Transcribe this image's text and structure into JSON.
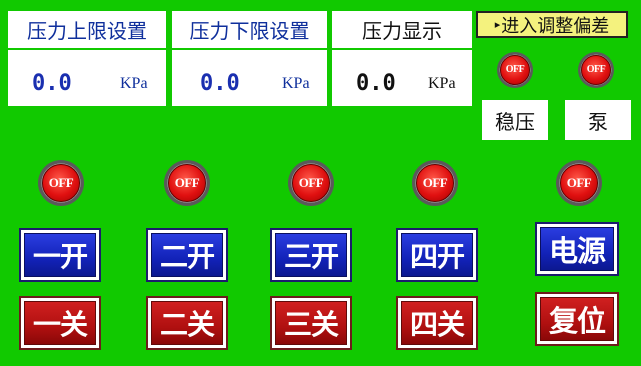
{
  "panels": {
    "upper_limit": {
      "title": "压力上限设置",
      "value": "0.0",
      "unit": "KPa"
    },
    "lower_limit": {
      "title": "压力下限设置",
      "value": "0.0",
      "unit": "KPa"
    },
    "display": {
      "title": "压力显示",
      "value": "0.0",
      "unit": "KPa"
    }
  },
  "adjust_button": {
    "label": "进入调整偏差",
    "arrow": "▸"
  },
  "indicators": {
    "stabilize": {
      "state": "OFF",
      "label": "稳压"
    },
    "pump": {
      "state": "OFF",
      "label": "泵"
    },
    "ch1": {
      "state": "OFF"
    },
    "ch2": {
      "state": "OFF"
    },
    "ch3": {
      "state": "OFF"
    },
    "ch4": {
      "state": "OFF"
    },
    "power": {
      "state": "OFF"
    }
  },
  "buttons": {
    "open1": "一开",
    "open2": "二开",
    "open3": "三开",
    "open4": "四开",
    "close1": "一关",
    "close2": "二关",
    "close3": "三关",
    "close4": "四关",
    "power": "电源",
    "reset": "复位"
  },
  "colors": {
    "background": "#11c900",
    "on_button": "#1222b8",
    "off_button": "#b01010",
    "indicator_off": "#e01010"
  }
}
